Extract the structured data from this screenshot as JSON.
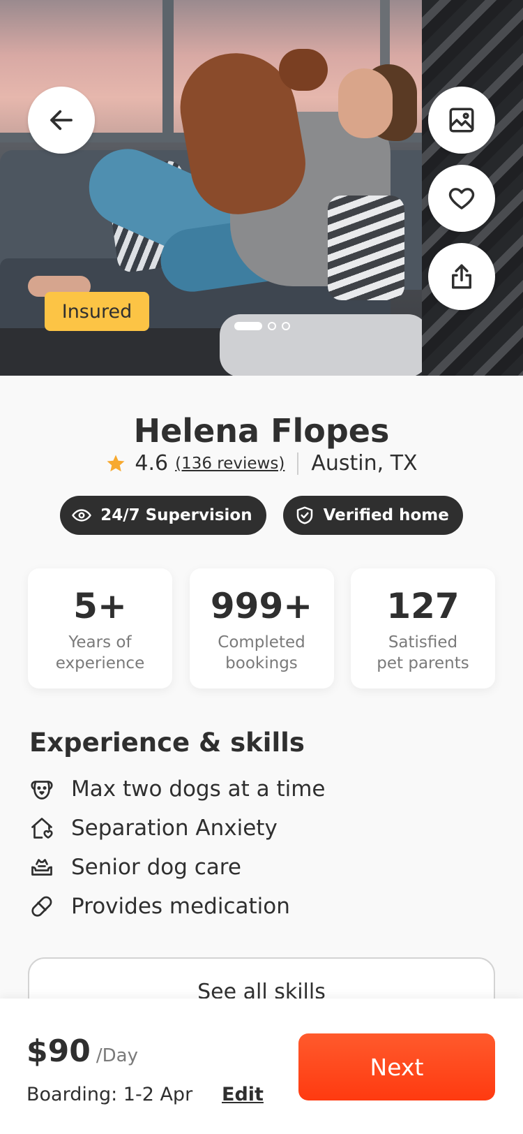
{
  "hero": {
    "badge": "Insured",
    "carousel": {
      "count": 3,
      "active": 0
    }
  },
  "profile": {
    "name": "Helena Flopes",
    "rating": "4.6",
    "reviews": "(136 reviews)",
    "location": "Austin, TX",
    "tags": [
      {
        "label": "24/7 Supervision",
        "icon": "eye-icon"
      },
      {
        "label": "Verified home",
        "icon": "shield-check-icon"
      }
    ]
  },
  "stats": [
    {
      "value": "5+",
      "label_line1": "Years of",
      "label_line2": "experience"
    },
    {
      "value": "999+",
      "label_line1": "Completed",
      "label_line2": "bookings"
    },
    {
      "value": "127",
      "label_line1": "Satisfied",
      "label_line2": "pet parents"
    }
  ],
  "skills": {
    "title": "Experience & skills",
    "items": [
      {
        "label": "Max two dogs at a time",
        "icon": "dog-face-icon"
      },
      {
        "label": "Separation Anxiety",
        "icon": "house-heart-icon"
      },
      {
        "label": "Senior dog care",
        "icon": "dog-bed-icon"
      },
      {
        "label": "Provides medication",
        "icon": "pill-icon"
      }
    ],
    "see_all": "See all skills"
  },
  "booking": {
    "price": "$90",
    "unit": "/Day",
    "dates": "Boarding: 1-2 Apr",
    "edit": "Edit",
    "next": "Next"
  },
  "colors": {
    "accent": "#ff4a1c",
    "badge": "#fcc445",
    "star": "#f7a92f",
    "dark": "#2f2f2f"
  }
}
